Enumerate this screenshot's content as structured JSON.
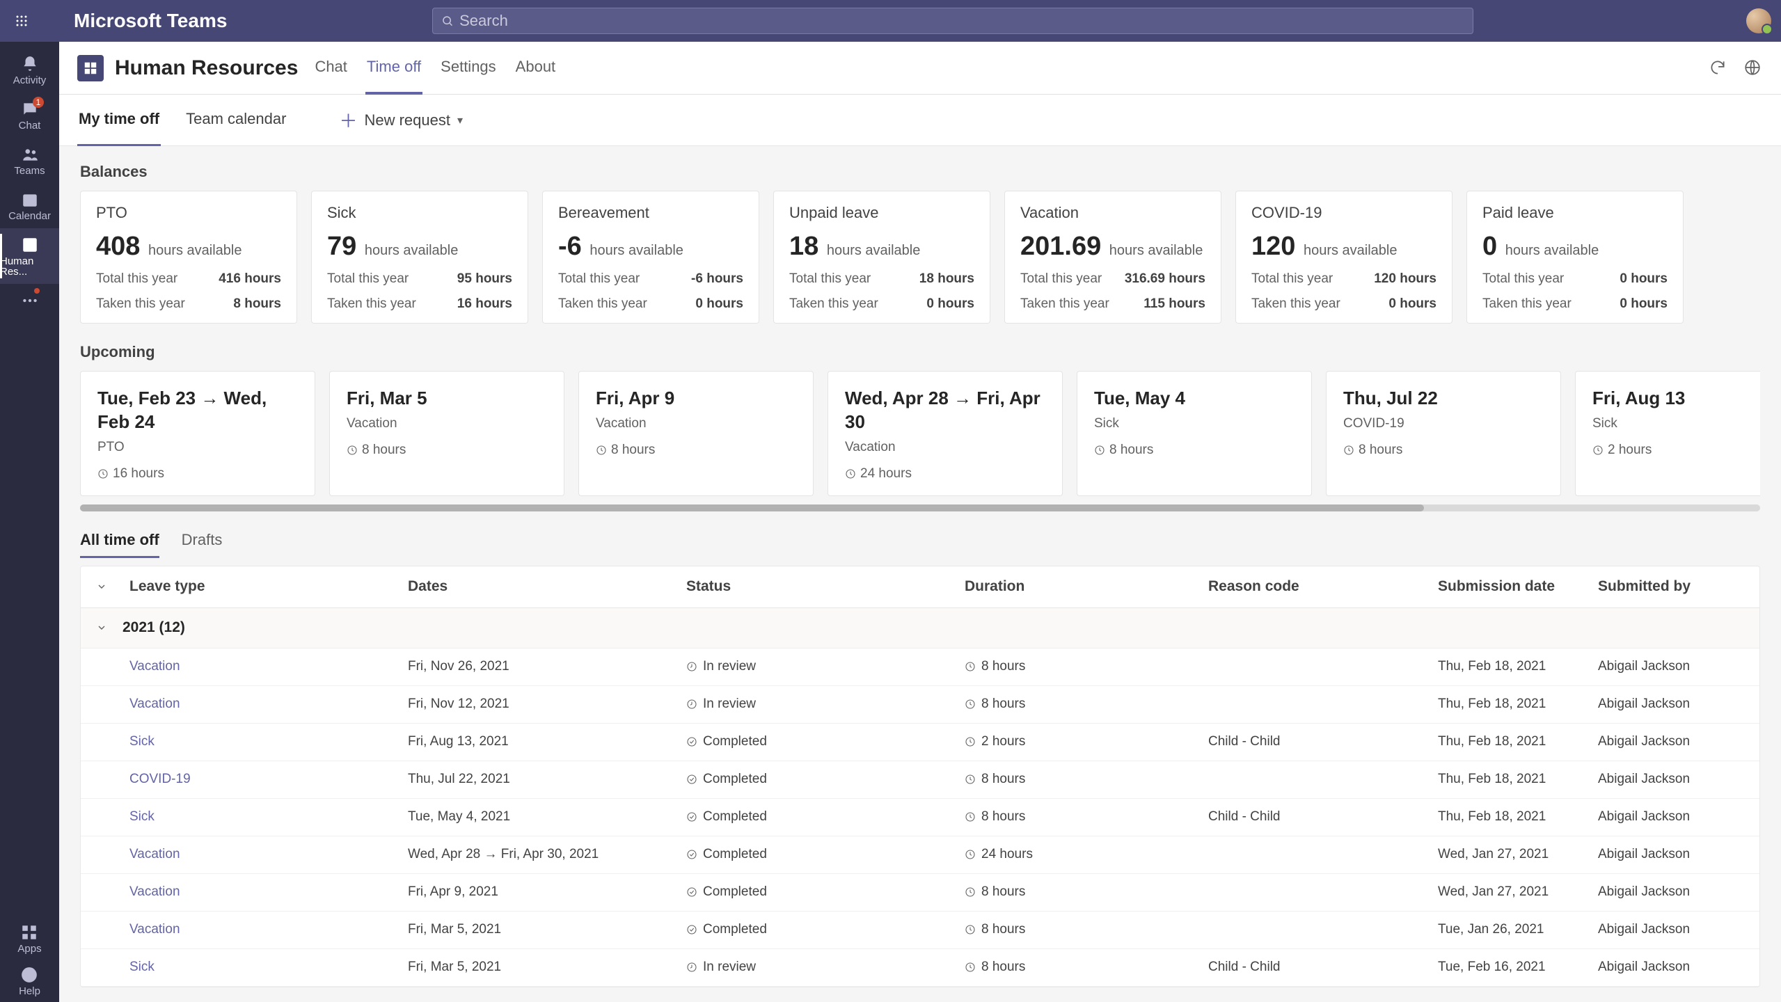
{
  "header": {
    "brand": "Microsoft Teams",
    "search_placeholder": "Search"
  },
  "rail": {
    "items": [
      {
        "id": "activity",
        "label": "Activity"
      },
      {
        "id": "chat",
        "label": "Chat",
        "badge": "1"
      },
      {
        "id": "teams",
        "label": "Teams"
      },
      {
        "id": "calendar",
        "label": "Calendar"
      },
      {
        "id": "hr",
        "label": "Human Res...",
        "active": true
      },
      {
        "id": "more",
        "label": ""
      }
    ],
    "bottom": [
      {
        "id": "apps",
        "label": "Apps"
      },
      {
        "id": "help",
        "label": "Help"
      }
    ]
  },
  "sub_header": {
    "title": "Human Resources",
    "tabs": [
      {
        "id": "chat",
        "label": "Chat"
      },
      {
        "id": "timeoff",
        "label": "Time off",
        "active": true
      },
      {
        "id": "settings",
        "label": "Settings"
      },
      {
        "id": "about",
        "label": "About"
      }
    ]
  },
  "toolbar": {
    "tabs": [
      {
        "id": "mytimeoff",
        "label": "My time off",
        "active": true
      },
      {
        "id": "teamcal",
        "label": "Team calendar"
      }
    ],
    "new_request": "New request"
  },
  "balances": {
    "title": "Balances",
    "hours_available_label": "hours available",
    "total_label": "Total this year",
    "taken_label": "Taken this year",
    "cards": [
      {
        "type": "PTO",
        "amount": "408",
        "total": "416 hours",
        "taken": "8 hours"
      },
      {
        "type": "Sick",
        "amount": "79",
        "total": "95 hours",
        "taken": "16 hours"
      },
      {
        "type": "Bereavement",
        "amount": "-6",
        "total": "-6 hours",
        "taken": "0 hours"
      },
      {
        "type": "Unpaid leave",
        "amount": "18",
        "total": "18 hours",
        "taken": "0 hours"
      },
      {
        "type": "Vacation",
        "amount": "201.69",
        "total": "316.69 hours",
        "taken": "115 hours"
      },
      {
        "type": "COVID-19",
        "amount": "120",
        "total": "120 hours",
        "taken": "0 hours"
      },
      {
        "type": "Paid leave",
        "amount": "0",
        "total": "0 hours",
        "taken": "0 hours"
      }
    ]
  },
  "upcoming": {
    "title": "Upcoming",
    "items": [
      {
        "date": "Tue, Feb 23 → Wed, Feb 24",
        "type": "PTO",
        "hours": "16 hours"
      },
      {
        "date": "Fri, Mar 5",
        "type": "Vacation",
        "hours": "8 hours"
      },
      {
        "date": "Fri, Apr 9",
        "type": "Vacation",
        "hours": "8 hours"
      },
      {
        "date": "Wed, Apr 28 → Fri, Apr 30",
        "type": "Vacation",
        "hours": "24 hours"
      },
      {
        "date": "Tue, May 4",
        "type": "Sick",
        "hours": "8 hours"
      },
      {
        "date": "Thu, Jul 22",
        "type": "COVID-19",
        "hours": "8 hours"
      },
      {
        "date": "Fri, Aug 13",
        "type": "Sick",
        "hours": "2 hours"
      }
    ]
  },
  "pivot": {
    "tabs": [
      {
        "id": "all",
        "label": "All time off",
        "active": true
      },
      {
        "id": "drafts",
        "label": "Drafts"
      }
    ]
  },
  "table": {
    "headers": {
      "leave": "Leave type",
      "dates": "Dates",
      "status": "Status",
      "duration": "Duration",
      "reason": "Reason code",
      "submission": "Submission date",
      "submitted_by": "Submitted by"
    },
    "group": "2021 (12)",
    "rows": [
      {
        "leave": "Vacation",
        "dates": "Fri, Nov 26, 2021",
        "status": "In review",
        "status_icon": "review",
        "duration": "8 hours",
        "reason": "",
        "submission": "Thu, Feb 18, 2021",
        "by": "Abigail Jackson"
      },
      {
        "leave": "Vacation",
        "dates": "Fri, Nov 12, 2021",
        "status": "In review",
        "status_icon": "review",
        "duration": "8 hours",
        "reason": "",
        "submission": "Thu, Feb 18, 2021",
        "by": "Abigail Jackson"
      },
      {
        "leave": "Sick",
        "dates": "Fri, Aug 13, 2021",
        "status": "Completed",
        "status_icon": "done",
        "duration": "2 hours",
        "reason": "Child - Child",
        "submission": "Thu, Feb 18, 2021",
        "by": "Abigail Jackson"
      },
      {
        "leave": "COVID-19",
        "dates": "Thu, Jul 22, 2021",
        "status": "Completed",
        "status_icon": "done",
        "duration": "8 hours",
        "reason": "",
        "submission": "Thu, Feb 18, 2021",
        "by": "Abigail Jackson"
      },
      {
        "leave": "Sick",
        "dates": "Tue, May 4, 2021",
        "status": "Completed",
        "status_icon": "done",
        "duration": "8 hours",
        "reason": "Child - Child",
        "submission": "Thu, Feb 18, 2021",
        "by": "Abigail Jackson"
      },
      {
        "leave": "Vacation",
        "dates": "Wed, Apr 28 → Fri, Apr 30, 2021",
        "status": "Completed",
        "status_icon": "done",
        "duration": "24 hours",
        "reason": "",
        "submission": "Wed, Jan 27, 2021",
        "by": "Abigail Jackson"
      },
      {
        "leave": "Vacation",
        "dates": "Fri, Apr 9, 2021",
        "status": "Completed",
        "status_icon": "done",
        "duration": "8 hours",
        "reason": "",
        "submission": "Wed, Jan 27, 2021",
        "by": "Abigail Jackson"
      },
      {
        "leave": "Vacation",
        "dates": "Fri, Mar 5, 2021",
        "status": "Completed",
        "status_icon": "done",
        "duration": "8 hours",
        "reason": "",
        "submission": "Tue, Jan 26, 2021",
        "by": "Abigail Jackson"
      },
      {
        "leave": "Sick",
        "dates": "Fri, Mar 5, 2021",
        "status": "In review",
        "status_icon": "review",
        "duration": "8 hours",
        "reason": "Child - Child",
        "submission": "Tue, Feb 16, 2021",
        "by": "Abigail Jackson"
      }
    ]
  }
}
